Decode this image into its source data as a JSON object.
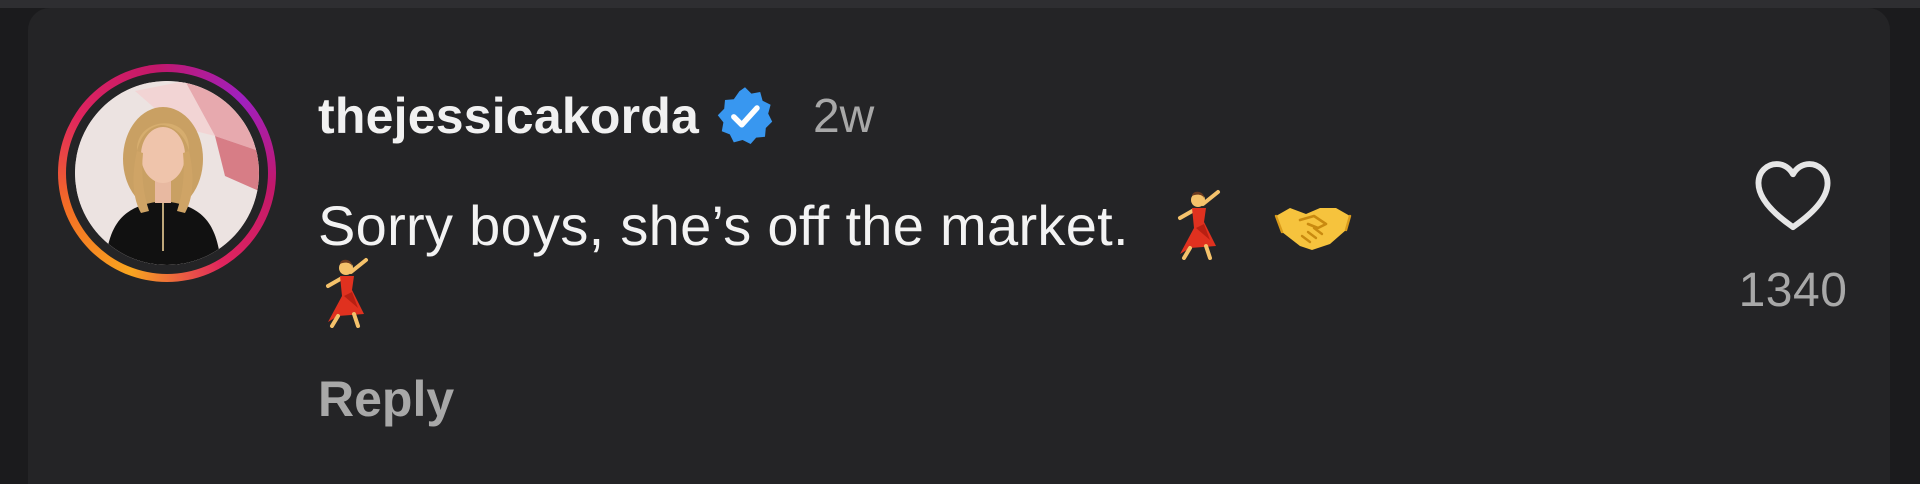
{
  "comment": {
    "username": "thejessicakorda",
    "verified_icon": "verified-badge-icon",
    "timestamp": "2w",
    "text": "Sorry boys, she’s off the market.",
    "emojis": [
      "woman-dancing",
      "handshake",
      "woman-dancing"
    ],
    "reply_label": "Reply",
    "like_icon": "heart-icon",
    "like_count": "1340"
  },
  "colors": {
    "background": "#242426",
    "text_primary": "#f3f3f3",
    "text_secondary": "#a8a8a8",
    "verified_blue": "#3897f0"
  }
}
